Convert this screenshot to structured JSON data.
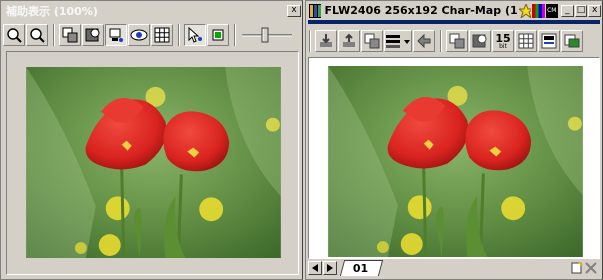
{
  "left_window": {
    "title": "補助表示 (100%)",
    "close_glyph": "x",
    "tools": [
      "zoom-in-icon",
      "zoom-out-icon",
      "copy-layer-icon",
      "mask-icon",
      "display-icon",
      "eye-icon",
      "grid-icon",
      "pointer-icon",
      "select-color-icon",
      "slider-icon"
    ]
  },
  "right_window": {
    "title": "FLW2406  256x192  Char-Map (1",
    "title_badge": "CM",
    "min_glyph": "_",
    "max_glyph": "□",
    "close_glyph": "x",
    "toolbar_badge": "15",
    "toolbar_badge_sub": "bit",
    "tab_label": "01"
  },
  "colors": {
    "chrome": "#d4d0c8",
    "viewport_bg": "#ffffff",
    "titlebar_active_rule": "#0a246a",
    "tulip_red": "#d9231f",
    "background_green": "#6d9a4c"
  }
}
